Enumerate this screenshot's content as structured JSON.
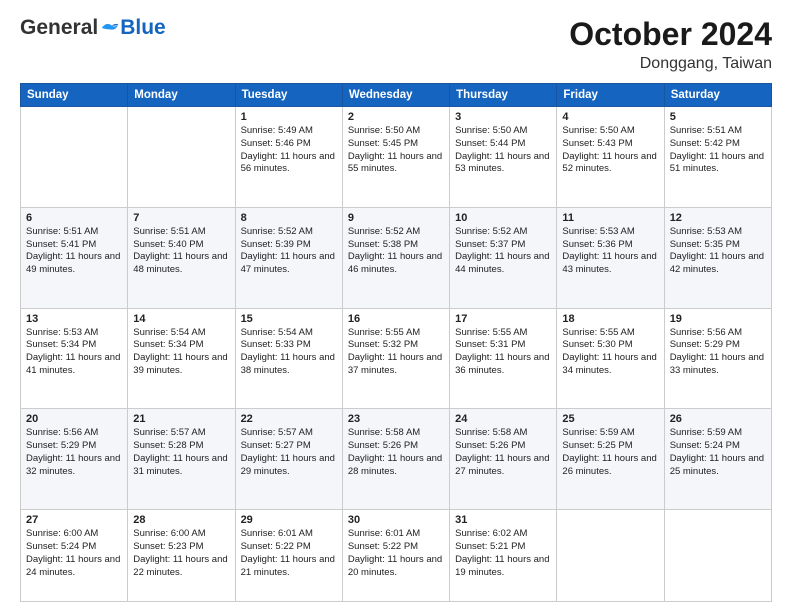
{
  "header": {
    "logo_general": "General",
    "logo_blue": "Blue",
    "month_title": "October 2024",
    "location": "Donggang, Taiwan"
  },
  "weekdays": [
    "Sunday",
    "Monday",
    "Tuesday",
    "Wednesday",
    "Thursday",
    "Friday",
    "Saturday"
  ],
  "weeks": [
    [
      {
        "day": "",
        "sunrise": "",
        "sunset": "",
        "daylight": ""
      },
      {
        "day": "",
        "sunrise": "",
        "sunset": "",
        "daylight": ""
      },
      {
        "day": "1",
        "sunrise": "Sunrise: 5:49 AM",
        "sunset": "Sunset: 5:46 PM",
        "daylight": "Daylight: 11 hours and 56 minutes."
      },
      {
        "day": "2",
        "sunrise": "Sunrise: 5:50 AM",
        "sunset": "Sunset: 5:45 PM",
        "daylight": "Daylight: 11 hours and 55 minutes."
      },
      {
        "day": "3",
        "sunrise": "Sunrise: 5:50 AM",
        "sunset": "Sunset: 5:44 PM",
        "daylight": "Daylight: 11 hours and 53 minutes."
      },
      {
        "day": "4",
        "sunrise": "Sunrise: 5:50 AM",
        "sunset": "Sunset: 5:43 PM",
        "daylight": "Daylight: 11 hours and 52 minutes."
      },
      {
        "day": "5",
        "sunrise": "Sunrise: 5:51 AM",
        "sunset": "Sunset: 5:42 PM",
        "daylight": "Daylight: 11 hours and 51 minutes."
      }
    ],
    [
      {
        "day": "6",
        "sunrise": "Sunrise: 5:51 AM",
        "sunset": "Sunset: 5:41 PM",
        "daylight": "Daylight: 11 hours and 49 minutes."
      },
      {
        "day": "7",
        "sunrise": "Sunrise: 5:51 AM",
        "sunset": "Sunset: 5:40 PM",
        "daylight": "Daylight: 11 hours and 48 minutes."
      },
      {
        "day": "8",
        "sunrise": "Sunrise: 5:52 AM",
        "sunset": "Sunset: 5:39 PM",
        "daylight": "Daylight: 11 hours and 47 minutes."
      },
      {
        "day": "9",
        "sunrise": "Sunrise: 5:52 AM",
        "sunset": "Sunset: 5:38 PM",
        "daylight": "Daylight: 11 hours and 46 minutes."
      },
      {
        "day": "10",
        "sunrise": "Sunrise: 5:52 AM",
        "sunset": "Sunset: 5:37 PM",
        "daylight": "Daylight: 11 hours and 44 minutes."
      },
      {
        "day": "11",
        "sunrise": "Sunrise: 5:53 AM",
        "sunset": "Sunset: 5:36 PM",
        "daylight": "Daylight: 11 hours and 43 minutes."
      },
      {
        "day": "12",
        "sunrise": "Sunrise: 5:53 AM",
        "sunset": "Sunset: 5:35 PM",
        "daylight": "Daylight: 11 hours and 42 minutes."
      }
    ],
    [
      {
        "day": "13",
        "sunrise": "Sunrise: 5:53 AM",
        "sunset": "Sunset: 5:34 PM",
        "daylight": "Daylight: 11 hours and 41 minutes."
      },
      {
        "day": "14",
        "sunrise": "Sunrise: 5:54 AM",
        "sunset": "Sunset: 5:34 PM",
        "daylight": "Daylight: 11 hours and 39 minutes."
      },
      {
        "day": "15",
        "sunrise": "Sunrise: 5:54 AM",
        "sunset": "Sunset: 5:33 PM",
        "daylight": "Daylight: 11 hours and 38 minutes."
      },
      {
        "day": "16",
        "sunrise": "Sunrise: 5:55 AM",
        "sunset": "Sunset: 5:32 PM",
        "daylight": "Daylight: 11 hours and 37 minutes."
      },
      {
        "day": "17",
        "sunrise": "Sunrise: 5:55 AM",
        "sunset": "Sunset: 5:31 PM",
        "daylight": "Daylight: 11 hours and 36 minutes."
      },
      {
        "day": "18",
        "sunrise": "Sunrise: 5:55 AM",
        "sunset": "Sunset: 5:30 PM",
        "daylight": "Daylight: 11 hours and 34 minutes."
      },
      {
        "day": "19",
        "sunrise": "Sunrise: 5:56 AM",
        "sunset": "Sunset: 5:29 PM",
        "daylight": "Daylight: 11 hours and 33 minutes."
      }
    ],
    [
      {
        "day": "20",
        "sunrise": "Sunrise: 5:56 AM",
        "sunset": "Sunset: 5:29 PM",
        "daylight": "Daylight: 11 hours and 32 minutes."
      },
      {
        "day": "21",
        "sunrise": "Sunrise: 5:57 AM",
        "sunset": "Sunset: 5:28 PM",
        "daylight": "Daylight: 11 hours and 31 minutes."
      },
      {
        "day": "22",
        "sunrise": "Sunrise: 5:57 AM",
        "sunset": "Sunset: 5:27 PM",
        "daylight": "Daylight: 11 hours and 29 minutes."
      },
      {
        "day": "23",
        "sunrise": "Sunrise: 5:58 AM",
        "sunset": "Sunset: 5:26 PM",
        "daylight": "Daylight: 11 hours and 28 minutes."
      },
      {
        "day": "24",
        "sunrise": "Sunrise: 5:58 AM",
        "sunset": "Sunset: 5:26 PM",
        "daylight": "Daylight: 11 hours and 27 minutes."
      },
      {
        "day": "25",
        "sunrise": "Sunrise: 5:59 AM",
        "sunset": "Sunset: 5:25 PM",
        "daylight": "Daylight: 11 hours and 26 minutes."
      },
      {
        "day": "26",
        "sunrise": "Sunrise: 5:59 AM",
        "sunset": "Sunset: 5:24 PM",
        "daylight": "Daylight: 11 hours and 25 minutes."
      }
    ],
    [
      {
        "day": "27",
        "sunrise": "Sunrise: 6:00 AM",
        "sunset": "Sunset: 5:24 PM",
        "daylight": "Daylight: 11 hours and 24 minutes."
      },
      {
        "day": "28",
        "sunrise": "Sunrise: 6:00 AM",
        "sunset": "Sunset: 5:23 PM",
        "daylight": "Daylight: 11 hours and 22 minutes."
      },
      {
        "day": "29",
        "sunrise": "Sunrise: 6:01 AM",
        "sunset": "Sunset: 5:22 PM",
        "daylight": "Daylight: 11 hours and 21 minutes."
      },
      {
        "day": "30",
        "sunrise": "Sunrise: 6:01 AM",
        "sunset": "Sunset: 5:22 PM",
        "daylight": "Daylight: 11 hours and 20 minutes."
      },
      {
        "day": "31",
        "sunrise": "Sunrise: 6:02 AM",
        "sunset": "Sunset: 5:21 PM",
        "daylight": "Daylight: 11 hours and 19 minutes."
      },
      {
        "day": "",
        "sunrise": "",
        "sunset": "",
        "daylight": ""
      },
      {
        "day": "",
        "sunrise": "",
        "sunset": "",
        "daylight": ""
      }
    ]
  ]
}
